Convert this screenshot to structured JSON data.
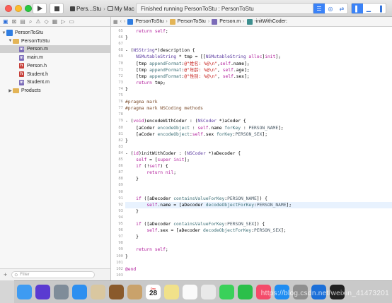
{
  "window": {
    "scheme_target": "Pers...Stu",
    "scheme_device": "My Mac",
    "status_text": "Finished running PersonToStu : PersonToStu"
  },
  "navigator": {
    "items": [
      {
        "label": "PersonToStu",
        "kind": "project",
        "depth": 0,
        "expanded": true
      },
      {
        "label": "PersonToStu",
        "kind": "group",
        "depth": 1,
        "expanded": true
      },
      {
        "label": "Person.m",
        "kind": "m",
        "depth": 2,
        "selected": true
      },
      {
        "label": "main.m",
        "kind": "m",
        "depth": 2
      },
      {
        "label": "Person.h",
        "kind": "h",
        "depth": 2
      },
      {
        "label": "Student.h",
        "kind": "h",
        "depth": 2
      },
      {
        "label": "Student.m",
        "kind": "m",
        "depth": 2
      },
      {
        "label": "Products",
        "kind": "group",
        "depth": 1,
        "expanded": false
      }
    ],
    "filter_placeholder": "Filter"
  },
  "jumpbar": {
    "project": "PersonToStu",
    "group": "PersonToStu",
    "file": "Person.m",
    "symbol": "-initWithCoder:"
  },
  "editor": {
    "current_line": 92,
    "lines": [
      {
        "n": 65,
        "t": "    return self;"
      },
      {
        "n": 66,
        "t": "}"
      },
      {
        "n": 67,
        "t": ""
      },
      {
        "n": 68,
        "t": "- (NSString*)description {"
      },
      {
        "n": 69,
        "t": "    NSMutableString * tmp = [[NSMutableString alloc]init];"
      },
      {
        "n": 70,
        "t": "    [tmp appendFormat:@\"姓名: %@\\n\",self.name];"
      },
      {
        "n": 71,
        "t": "    [tmp appendFormat:@\"年龄: %@\\n\", self.age];"
      },
      {
        "n": 72,
        "t": "    [tmp appendFormat:@\"性别: %@\\n\", self.sex];"
      },
      {
        "n": 73,
        "t": "    return tmp;"
      },
      {
        "n": 74,
        "t": "}"
      },
      {
        "n": 75,
        "t": ""
      },
      {
        "n": 76,
        "t": "#pragma mark"
      },
      {
        "n": 77,
        "t": "#pragma mark NSCoding methods"
      },
      {
        "n": 78,
        "t": ""
      },
      {
        "n": 79,
        "t": "- (void)encodeWithCoder : (NSCoder *)aCoder {"
      },
      {
        "n": 80,
        "t": "    [aCoder encodeObject : self.name forKey : PERSON_NAME];"
      },
      {
        "n": 81,
        "t": "    [aCoder encodeObject:self.sex forKey:PERSON_SEX];"
      },
      {
        "n": 82,
        "t": "}"
      },
      {
        "n": 83,
        "t": ""
      },
      {
        "n": 84,
        "t": "- (id)initWithCoder : (NSCoder *)aDecoder {"
      },
      {
        "n": 85,
        "t": "    self = [super init];"
      },
      {
        "n": 86,
        "t": "    if (!self) {"
      },
      {
        "n": 87,
        "t": "        return nil;"
      },
      {
        "n": 88,
        "t": "    }"
      },
      {
        "n": 89,
        "t": ""
      },
      {
        "n": 90,
        "t": ""
      },
      {
        "n": 91,
        "t": "    if ([aDecoder containsValueForKey:PERSON_NAME]) {"
      },
      {
        "n": 92,
        "t": "        self.name = [aDecoder decodeObjectForKey:PERSON_NAME];"
      },
      {
        "n": 93,
        "t": "    }"
      },
      {
        "n": 94,
        "t": ""
      },
      {
        "n": 95,
        "t": "    if ([aDecoder containsValueForKey:PERSON_SEX]) {"
      },
      {
        "n": 96,
        "t": "        self.sex = [aDecoder decodeObjectForKey:PERSON_SEX];"
      },
      {
        "n": 97,
        "t": "    }"
      },
      {
        "n": 98,
        "t": ""
      },
      {
        "n": 99,
        "t": "    return self;"
      },
      {
        "n": 100,
        "t": "}"
      },
      {
        "n": 101,
        "t": ""
      },
      {
        "n": 102,
        "t": "@end"
      },
      {
        "n": 103,
        "t": ""
      }
    ]
  },
  "dock": {
    "calendar_day": "28",
    "calendar_month": "Dec",
    "icons": [
      "finder-icon",
      "siri-icon",
      "launchpad-icon",
      "safari-icon",
      "photos-app-icon",
      "notes-app-icon",
      "contacts-icon",
      "calendar-icon",
      "stickies-icon",
      "reminders-icon",
      "photos-icon",
      "messages-icon",
      "facetime-icon",
      "music-icon",
      "app-store-icon",
      "preferences-icon",
      "xcode-icon",
      "terminal-icon"
    ],
    "watermark": "https://blog.csdn.net/weixin_41473201"
  },
  "colors": {
    "accent": "#3a82f7",
    "selection": "#d0d0d0",
    "current_line": "#e8f2fe"
  }
}
